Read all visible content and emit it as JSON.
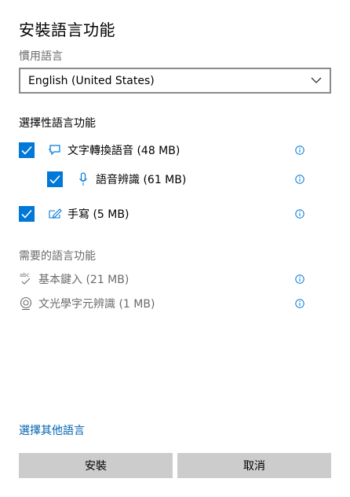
{
  "dialog": {
    "title": "安裝語言功能",
    "preferred_language_label": "慣用語言",
    "selected_language": "English (United States)"
  },
  "optional_features": {
    "heading": "選擇性語言功能",
    "items": [
      {
        "label": "文字轉換語音 (48 MB)",
        "icon": "speech-bubble-icon",
        "checked": true
      },
      {
        "label": "語音辨識 (61 MB)",
        "icon": "microphone-icon",
        "checked": true
      },
      {
        "label": "手寫 (5 MB)",
        "icon": "pen-icon",
        "checked": true
      }
    ]
  },
  "required_features": {
    "heading": "需要的語言功能",
    "items": [
      {
        "label": "基本鍵入 (21 MB)",
        "icon": "abc-spellcheck-icon"
      },
      {
        "label": "文光學字元辨識 (1 MB)",
        "icon": "ocr-camera-icon"
      }
    ]
  },
  "footer": {
    "choose_other_link": "選擇其他語言",
    "install_label": "安裝",
    "cancel_label": "取消"
  },
  "colors": {
    "accent": "#0078d7",
    "link": "#0063b1",
    "muted_text": "#6b6b6b",
    "button_bg": "#cccccc"
  }
}
